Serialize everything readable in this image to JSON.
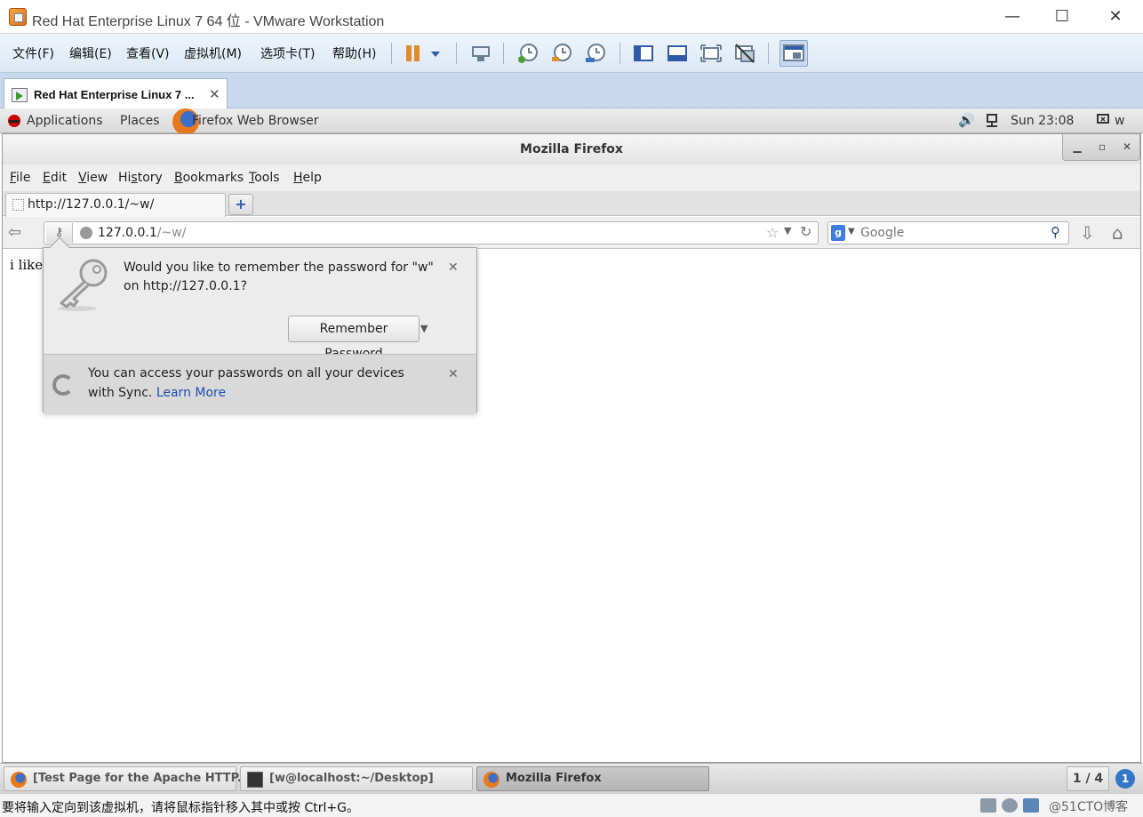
{
  "vmware": {
    "title": "Red Hat Enterprise Linux 7 64 位 - VMware Workstation",
    "window_controls": {
      "minimize": "—",
      "maximize": "☐",
      "close": "✕"
    },
    "menu": [
      "文件(F)",
      "编辑(E)",
      "查看(V)",
      "虚拟机(M)",
      "选项卡(T)",
      "帮助(H)"
    ],
    "tab_label": "Red Hat Enterprise Linux 7 ...",
    "tab_close": "✕",
    "status_text": "要将输入定向到该虚拟机，请将鼠标指针移入其中或按 Ctrl+G。",
    "watermark": "@51CTO博客"
  },
  "gnome": {
    "applications": "Applications",
    "places": "Places",
    "launcher": "Firefox Web Browser",
    "clock": "Sun 23:08",
    "user": "w",
    "tasks": [
      {
        "label": "[Test Page for the Apache HTTP...",
        "active": false
      },
      {
        "label": "[w@localhost:~/Desktop]",
        "active": false
      },
      {
        "label": "Mozilla Firefox",
        "active": true
      }
    ],
    "workspace": "1 / 4"
  },
  "firefox": {
    "title": "Mozilla Firefox",
    "menu": [
      {
        "acc": "F",
        "rest": "ile"
      },
      {
        "acc": "E",
        "rest": "dit"
      },
      {
        "acc": "V",
        "rest": "iew"
      },
      {
        "pre": "Hi",
        "acc": "s",
        "rest": "tory"
      },
      {
        "acc": "B",
        "rest": "ookmarks"
      },
      {
        "acc": "T",
        "rest": "ools"
      },
      {
        "acc": "H",
        "rest": "elp"
      }
    ],
    "tab_label": "http://127.0.0.1/~w/",
    "url_host": "127.0.0.1",
    "url_path": "/~w/",
    "search_placeholder": "Google",
    "page_text": "i like"
  },
  "password_prompt": {
    "message": "Would you like to remember the password for \"w\" on http://127.0.0.1?",
    "remember_button": "Remember Password",
    "sync_text": "You can access your passwords on all your devices with Sync.",
    "learn_more": "Learn More"
  },
  "colors": {
    "accent_blue": "#1d4fb0",
    "vm_toolbar": "#dde8f5",
    "pause_orange": "#e38a2b"
  }
}
